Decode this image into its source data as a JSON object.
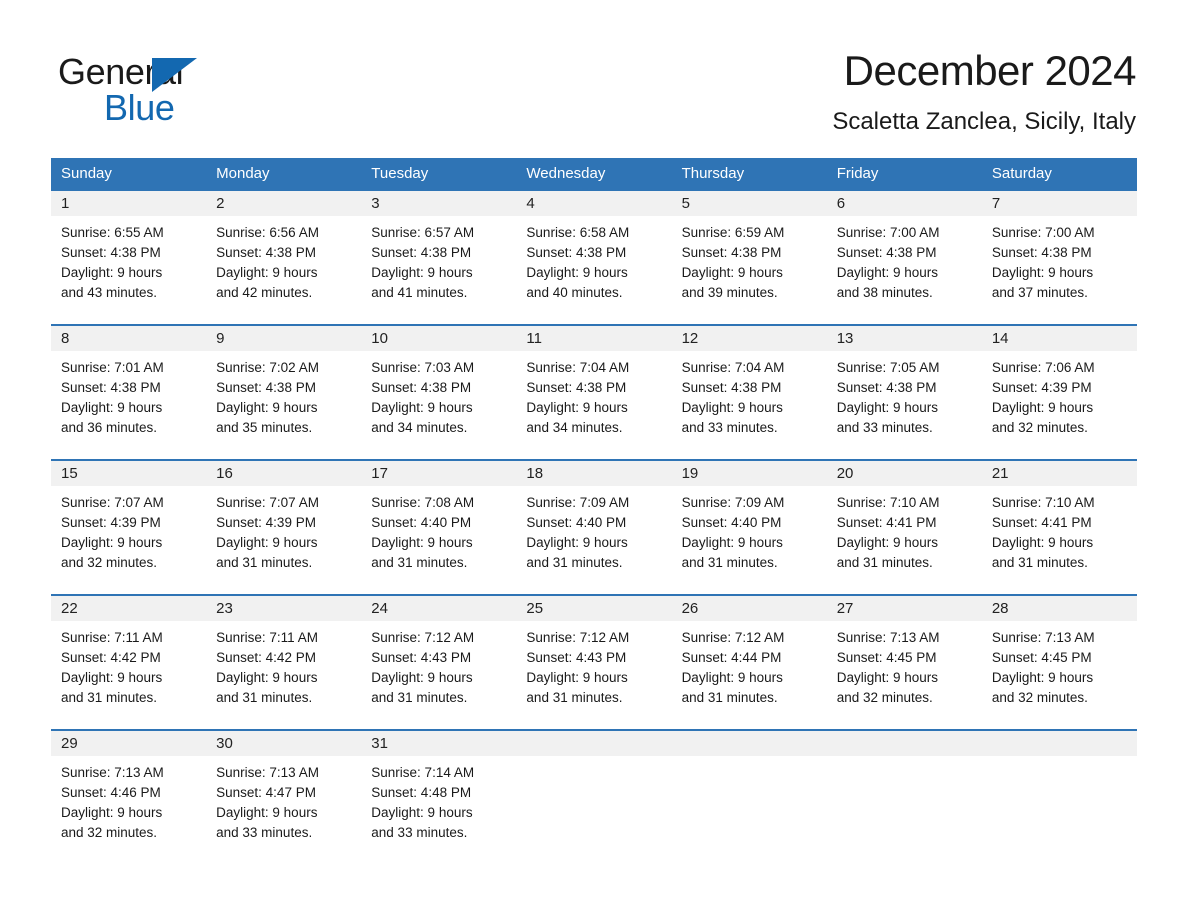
{
  "brand": {
    "name_part1": "General",
    "name_part2": "Blue",
    "triangle_icon": "triangle-icon",
    "primary_color": "#1368b0"
  },
  "header": {
    "title": "December 2024",
    "subtitle": "Scaletta Zanclea, Sicily, Italy"
  },
  "theme": {
    "header_blue": "#2f74b5",
    "rule_blue": "#2f74b5",
    "date_band": "#f1f1f1",
    "text": "#1a1a1a"
  },
  "weekdays": [
    "Sunday",
    "Monday",
    "Tuesday",
    "Wednesday",
    "Thursday",
    "Friday",
    "Saturday"
  ],
  "weeks": [
    {
      "days": [
        {
          "date": "1",
          "sunrise": "Sunrise: 6:55 AM",
          "sunset": "Sunset: 4:38 PM",
          "daylight_1": "Daylight: 9 hours",
          "daylight_2": "and 43 minutes."
        },
        {
          "date": "2",
          "sunrise": "Sunrise: 6:56 AM",
          "sunset": "Sunset: 4:38 PM",
          "daylight_1": "Daylight: 9 hours",
          "daylight_2": "and 42 minutes."
        },
        {
          "date": "3",
          "sunrise": "Sunrise: 6:57 AM",
          "sunset": "Sunset: 4:38 PM",
          "daylight_1": "Daylight: 9 hours",
          "daylight_2": "and 41 minutes."
        },
        {
          "date": "4",
          "sunrise": "Sunrise: 6:58 AM",
          "sunset": "Sunset: 4:38 PM",
          "daylight_1": "Daylight: 9 hours",
          "daylight_2": "and 40 minutes."
        },
        {
          "date": "5",
          "sunrise": "Sunrise: 6:59 AM",
          "sunset": "Sunset: 4:38 PM",
          "daylight_1": "Daylight: 9 hours",
          "daylight_2": "and 39 minutes."
        },
        {
          "date": "6",
          "sunrise": "Sunrise: 7:00 AM",
          "sunset": "Sunset: 4:38 PM",
          "daylight_1": "Daylight: 9 hours",
          "daylight_2": "and 38 minutes."
        },
        {
          "date": "7",
          "sunrise": "Sunrise: 7:00 AM",
          "sunset": "Sunset: 4:38 PM",
          "daylight_1": "Daylight: 9 hours",
          "daylight_2": "and 37 minutes."
        }
      ]
    },
    {
      "days": [
        {
          "date": "8",
          "sunrise": "Sunrise: 7:01 AM",
          "sunset": "Sunset: 4:38 PM",
          "daylight_1": "Daylight: 9 hours",
          "daylight_2": "and 36 minutes."
        },
        {
          "date": "9",
          "sunrise": "Sunrise: 7:02 AM",
          "sunset": "Sunset: 4:38 PM",
          "daylight_1": "Daylight: 9 hours",
          "daylight_2": "and 35 minutes."
        },
        {
          "date": "10",
          "sunrise": "Sunrise: 7:03 AM",
          "sunset": "Sunset: 4:38 PM",
          "daylight_1": "Daylight: 9 hours",
          "daylight_2": "and 34 minutes."
        },
        {
          "date": "11",
          "sunrise": "Sunrise: 7:04 AM",
          "sunset": "Sunset: 4:38 PM",
          "daylight_1": "Daylight: 9 hours",
          "daylight_2": "and 34 minutes."
        },
        {
          "date": "12",
          "sunrise": "Sunrise: 7:04 AM",
          "sunset": "Sunset: 4:38 PM",
          "daylight_1": "Daylight: 9 hours",
          "daylight_2": "and 33 minutes."
        },
        {
          "date": "13",
          "sunrise": "Sunrise: 7:05 AM",
          "sunset": "Sunset: 4:38 PM",
          "daylight_1": "Daylight: 9 hours",
          "daylight_2": "and 33 minutes."
        },
        {
          "date": "14",
          "sunrise": "Sunrise: 7:06 AM",
          "sunset": "Sunset: 4:39 PM",
          "daylight_1": "Daylight: 9 hours",
          "daylight_2": "and 32 minutes."
        }
      ]
    },
    {
      "days": [
        {
          "date": "15",
          "sunrise": "Sunrise: 7:07 AM",
          "sunset": "Sunset: 4:39 PM",
          "daylight_1": "Daylight: 9 hours",
          "daylight_2": "and 32 minutes."
        },
        {
          "date": "16",
          "sunrise": "Sunrise: 7:07 AM",
          "sunset": "Sunset: 4:39 PM",
          "daylight_1": "Daylight: 9 hours",
          "daylight_2": "and 31 minutes."
        },
        {
          "date": "17",
          "sunrise": "Sunrise: 7:08 AM",
          "sunset": "Sunset: 4:40 PM",
          "daylight_1": "Daylight: 9 hours",
          "daylight_2": "and 31 minutes."
        },
        {
          "date": "18",
          "sunrise": "Sunrise: 7:09 AM",
          "sunset": "Sunset: 4:40 PM",
          "daylight_1": "Daylight: 9 hours",
          "daylight_2": "and 31 minutes."
        },
        {
          "date": "19",
          "sunrise": "Sunrise: 7:09 AM",
          "sunset": "Sunset: 4:40 PM",
          "daylight_1": "Daylight: 9 hours",
          "daylight_2": "and 31 minutes."
        },
        {
          "date": "20",
          "sunrise": "Sunrise: 7:10 AM",
          "sunset": "Sunset: 4:41 PM",
          "daylight_1": "Daylight: 9 hours",
          "daylight_2": "and 31 minutes."
        },
        {
          "date": "21",
          "sunrise": "Sunrise: 7:10 AM",
          "sunset": "Sunset: 4:41 PM",
          "daylight_1": "Daylight: 9 hours",
          "daylight_2": "and 31 minutes."
        }
      ]
    },
    {
      "days": [
        {
          "date": "22",
          "sunrise": "Sunrise: 7:11 AM",
          "sunset": "Sunset: 4:42 PM",
          "daylight_1": "Daylight: 9 hours",
          "daylight_2": "and 31 minutes."
        },
        {
          "date": "23",
          "sunrise": "Sunrise: 7:11 AM",
          "sunset": "Sunset: 4:42 PM",
          "daylight_1": "Daylight: 9 hours",
          "daylight_2": "and 31 minutes."
        },
        {
          "date": "24",
          "sunrise": "Sunrise: 7:12 AM",
          "sunset": "Sunset: 4:43 PM",
          "daylight_1": "Daylight: 9 hours",
          "daylight_2": "and 31 minutes."
        },
        {
          "date": "25",
          "sunrise": "Sunrise: 7:12 AM",
          "sunset": "Sunset: 4:43 PM",
          "daylight_1": "Daylight: 9 hours",
          "daylight_2": "and 31 minutes."
        },
        {
          "date": "26",
          "sunrise": "Sunrise: 7:12 AM",
          "sunset": "Sunset: 4:44 PM",
          "daylight_1": "Daylight: 9 hours",
          "daylight_2": "and 31 minutes."
        },
        {
          "date": "27",
          "sunrise": "Sunrise: 7:13 AM",
          "sunset": "Sunset: 4:45 PM",
          "daylight_1": "Daylight: 9 hours",
          "daylight_2": "and 32 minutes."
        },
        {
          "date": "28",
          "sunrise": "Sunrise: 7:13 AM",
          "sunset": "Sunset: 4:45 PM",
          "daylight_1": "Daylight: 9 hours",
          "daylight_2": "and 32 minutes."
        }
      ]
    },
    {
      "days": [
        {
          "date": "29",
          "sunrise": "Sunrise: 7:13 AM",
          "sunset": "Sunset: 4:46 PM",
          "daylight_1": "Daylight: 9 hours",
          "daylight_2": "and 32 minutes."
        },
        {
          "date": "30",
          "sunrise": "Sunrise: 7:13 AM",
          "sunset": "Sunset: 4:47 PM",
          "daylight_1": "Daylight: 9 hours",
          "daylight_2": "and 33 minutes."
        },
        {
          "date": "31",
          "sunrise": "Sunrise: 7:14 AM",
          "sunset": "Sunset: 4:48 PM",
          "daylight_1": "Daylight: 9 hours",
          "daylight_2": "and 33 minutes."
        },
        {
          "date": "",
          "sunrise": "",
          "sunset": "",
          "daylight_1": "",
          "daylight_2": ""
        },
        {
          "date": "",
          "sunrise": "",
          "sunset": "",
          "daylight_1": "",
          "daylight_2": ""
        },
        {
          "date": "",
          "sunrise": "",
          "sunset": "",
          "daylight_1": "",
          "daylight_2": ""
        },
        {
          "date": "",
          "sunrise": "",
          "sunset": "",
          "daylight_1": "",
          "daylight_2": ""
        }
      ]
    }
  ]
}
